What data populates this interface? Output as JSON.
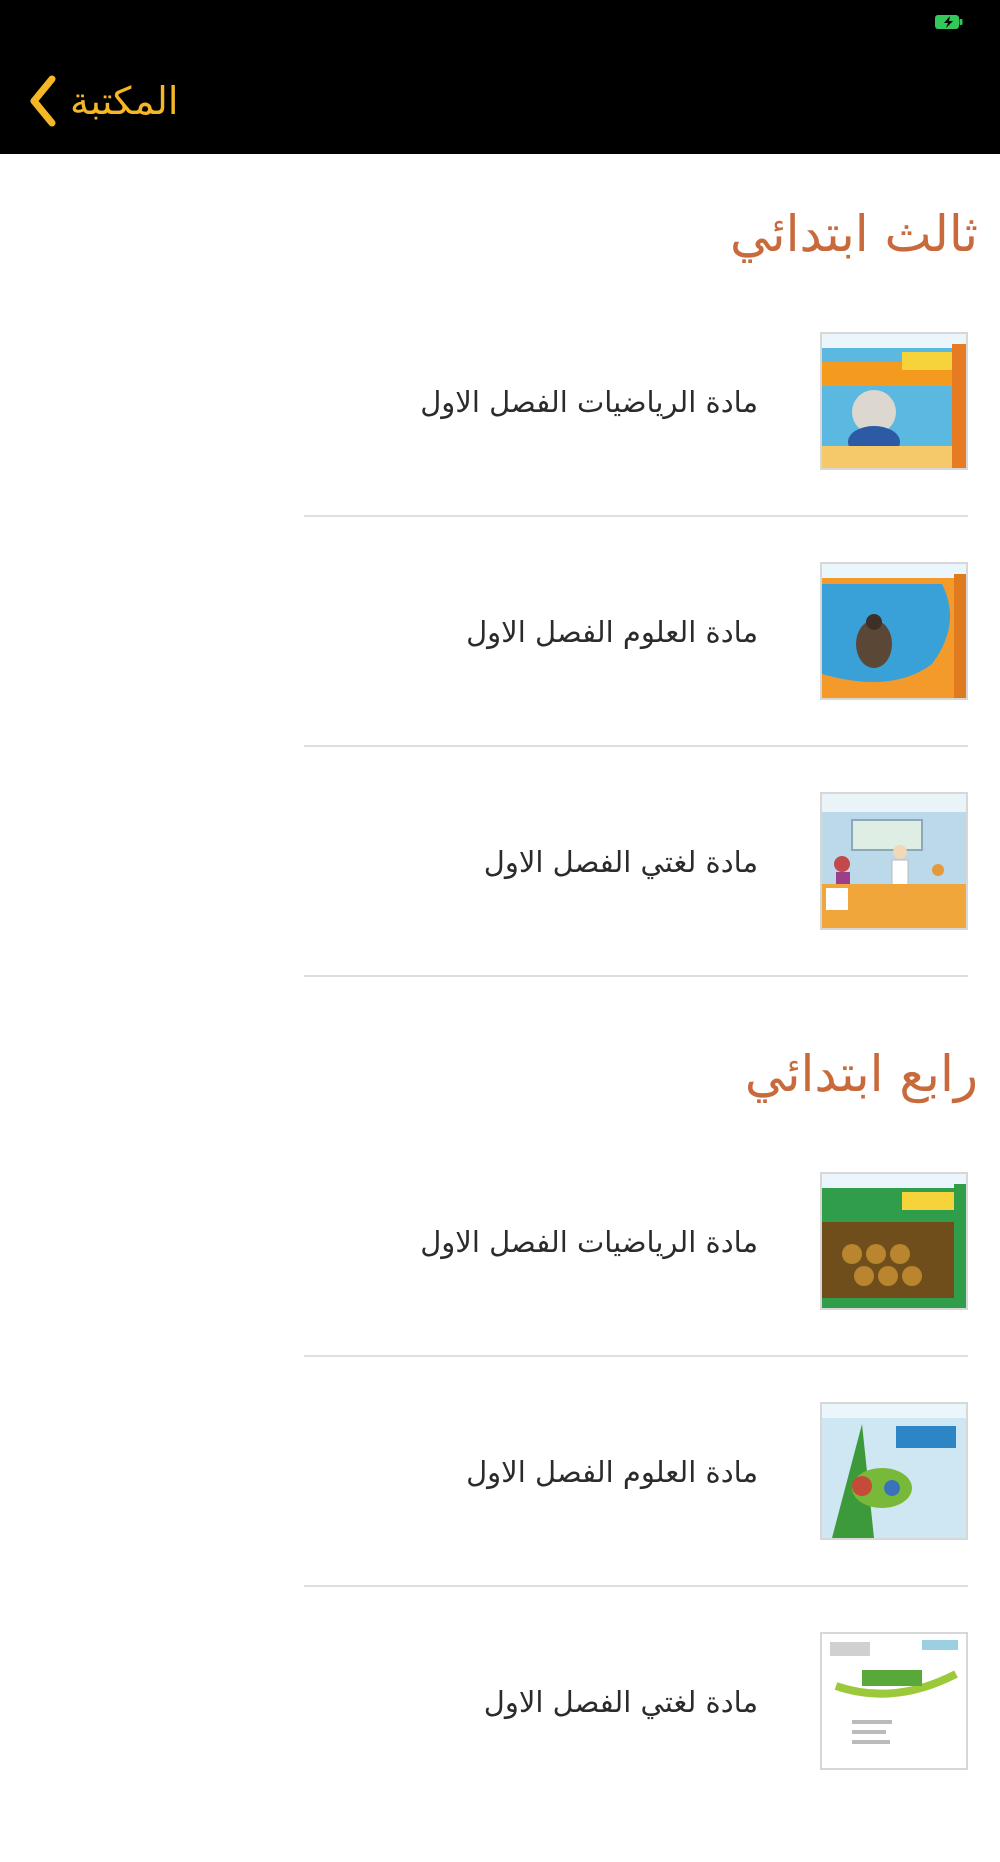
{
  "nav": {
    "back_label": "المكتبة"
  },
  "sections": [
    {
      "title": "ثالث ابتدائي",
      "items": [
        {
          "label": "مادة الرياضيات الفصل الاول",
          "cover": "math-book-cover"
        },
        {
          "label": "مادة العلوم الفصل الاول",
          "cover": "science-book-cover"
        },
        {
          "label": "مادة لغتي الفصل الاول",
          "cover": "arabic-book-cover"
        }
      ]
    },
    {
      "title": "رابع ابتدائي",
      "items": [
        {
          "label": "مادة الرياضيات الفصل الاول",
          "cover": "math-book-cover"
        },
        {
          "label": "مادة العلوم الفصل الاول",
          "cover": "science-book-cover"
        },
        {
          "label": "مادة لغتي الفصل الاول",
          "cover": "arabic-book-cover"
        }
      ]
    }
  ],
  "colors": {
    "accent": "#f5b726",
    "section_title": "#c96a3c",
    "nav_background": "#000000"
  }
}
